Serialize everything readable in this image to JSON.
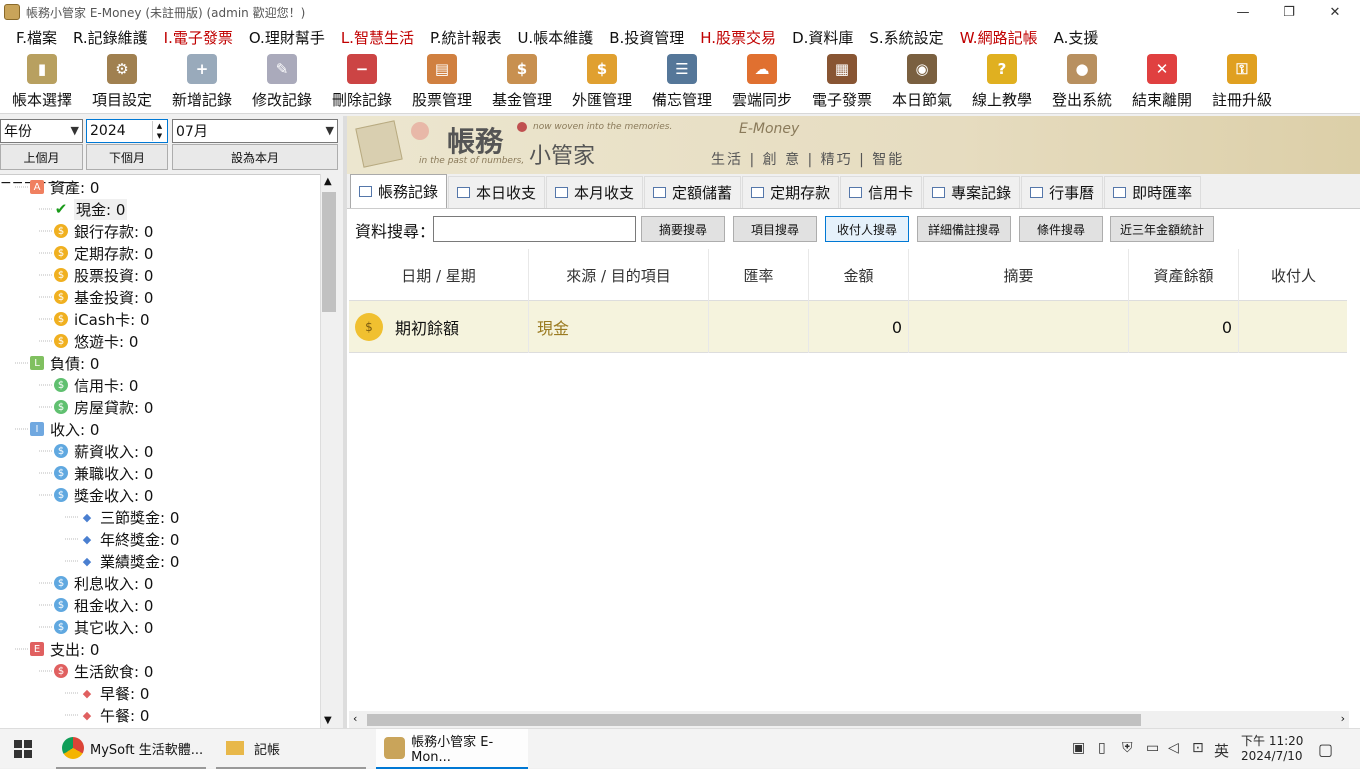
{
  "window": {
    "title": "帳務小管家 E-Money (未註冊版) (admin 歡迎您！)",
    "min": "—",
    "max": "❐",
    "close": "✕"
  },
  "menu": [
    {
      "label": "F.檔案",
      "color": "#111"
    },
    {
      "label": "R.記錄維護",
      "color": "#111"
    },
    {
      "label": "I.電子發票",
      "color": "#c00000"
    },
    {
      "label": "O.理財幫手",
      "color": "#111"
    },
    {
      "label": "L.智慧生活",
      "color": "#c00000"
    },
    {
      "label": "P.統計報表",
      "color": "#111"
    },
    {
      "label": "U.帳本維護",
      "color": "#111"
    },
    {
      "label": "B.投資管理",
      "color": "#111"
    },
    {
      "label": "H.股票交易",
      "color": "#c00000"
    },
    {
      "label": "D.資料庫",
      "color": "#111"
    },
    {
      "label": "S.系統設定",
      "color": "#111"
    },
    {
      "label": "W.網路記帳",
      "color": "#c00000"
    },
    {
      "label": "A.支援",
      "color": "#111"
    }
  ],
  "toolbar": [
    {
      "label": "帳本選擇",
      "icon": "book-icon",
      "color": "#b8a060",
      "glyph": "▮"
    },
    {
      "label": "項目設定",
      "icon": "settings-icon",
      "color": "#a08050",
      "glyph": "⚙"
    },
    {
      "label": "新增記錄",
      "icon": "add-record-icon",
      "color": "#9ab",
      "glyph": "+"
    },
    {
      "label": "修改記錄",
      "icon": "edit-record-icon",
      "color": "#aab",
      "glyph": "✎"
    },
    {
      "label": "刪除記錄",
      "icon": "delete-record-icon",
      "color": "#c44",
      "glyph": "−"
    },
    {
      "label": "股票管理",
      "icon": "stock-icon",
      "color": "#d08040",
      "glyph": "▤"
    },
    {
      "label": "基金管理",
      "icon": "fund-icon",
      "color": "#c89050",
      "glyph": "$"
    },
    {
      "label": "外匯管理",
      "icon": "forex-icon",
      "color": "#e0a030",
      "glyph": "$"
    },
    {
      "label": "備忘管理",
      "icon": "memo-icon",
      "color": "#557799",
      "glyph": "☰"
    },
    {
      "label": "雲端同步",
      "icon": "cloud-sync-icon",
      "color": "#e07030",
      "glyph": "☁"
    },
    {
      "label": "電子發票",
      "icon": "qr-invoice-icon",
      "color": "#885533",
      "glyph": "▦"
    },
    {
      "label": "本日節氣",
      "icon": "solar-term-icon",
      "color": "#7a6040",
      "glyph": "◉"
    },
    {
      "label": "線上教學",
      "icon": "help-icon",
      "color": "#e0b020",
      "glyph": "?"
    },
    {
      "label": "登出系統",
      "icon": "logout-icon",
      "color": "#b89060",
      "glyph": "●"
    },
    {
      "label": "結束離開",
      "icon": "exit-icon",
      "color": "#e04040",
      "glyph": "✕"
    },
    {
      "label": "註冊升級",
      "icon": "register-key-icon",
      "color": "#e0a020",
      "glyph": "⚿"
    }
  ],
  "left": {
    "period_type": "年份",
    "year": "2024",
    "month": "07月",
    "prev_month": "上個月",
    "next_month": "下個月",
    "set_this_month": "設為本月"
  },
  "tree": [
    {
      "label": "資產: 0",
      "level": 0,
      "badge": "A",
      "badge_color": "#f08060",
      "expander": "−"
    },
    {
      "label": "現金: 0",
      "level": 1,
      "badge": "✔",
      "badge_color": "#1a9a1a",
      "selected": true
    },
    {
      "label": "銀行存款: 0",
      "level": 1,
      "badge": "$",
      "badge_color": "#f0b020"
    },
    {
      "label": "定期存款: 0",
      "level": 1,
      "badge": "$",
      "badge_color": "#f0b020"
    },
    {
      "label": "股票投資: 0",
      "level": 1,
      "badge": "$",
      "badge_color": "#f0b020"
    },
    {
      "label": "基金投資: 0",
      "level": 1,
      "badge": "$",
      "badge_color": "#f0b020"
    },
    {
      "label": "iCash卡: 0",
      "level": 1,
      "badge": "$",
      "badge_color": "#f0b020"
    },
    {
      "label": "悠遊卡: 0",
      "level": 1,
      "badge": "$",
      "badge_color": "#f0b020"
    },
    {
      "label": "負債: 0",
      "level": 0,
      "badge": "L",
      "badge_color": "#80c060",
      "expander": "−"
    },
    {
      "label": "信用卡: 0",
      "level": 1,
      "badge": "$",
      "badge_color": "#60c070"
    },
    {
      "label": "房屋貸款: 0",
      "level": 1,
      "badge": "$",
      "badge_color": "#60c070"
    },
    {
      "label": "收入: 0",
      "level": 0,
      "badge": "I",
      "badge_color": "#70a8e0",
      "expander": "−"
    },
    {
      "label": "薪資收入: 0",
      "level": 1,
      "badge": "$",
      "badge_color": "#60a8e0"
    },
    {
      "label": "兼職收入: 0",
      "level": 1,
      "badge": "$",
      "badge_color": "#60a8e0"
    },
    {
      "label": "獎金收入: 0",
      "level": 1,
      "badge": "$",
      "badge_color": "#60a8e0",
      "expander": "−"
    },
    {
      "label": "三節獎金: 0",
      "level": 2,
      "badge": "◆",
      "badge_color": "#4a7fd0"
    },
    {
      "label": "年終獎金: 0",
      "level": 2,
      "badge": "◆",
      "badge_color": "#4a7fd0"
    },
    {
      "label": "業績獎金: 0",
      "level": 2,
      "badge": "◆",
      "badge_color": "#4a7fd0"
    },
    {
      "label": "利息收入: 0",
      "level": 1,
      "badge": "$",
      "badge_color": "#60a8e0"
    },
    {
      "label": "租金收入: 0",
      "level": 1,
      "badge": "$",
      "badge_color": "#60a8e0"
    },
    {
      "label": "其它收入: 0",
      "level": 1,
      "badge": "$",
      "badge_color": "#60a8e0"
    },
    {
      "label": "支出: 0",
      "level": 0,
      "badge": "E",
      "badge_color": "#e06060",
      "expander": "−"
    },
    {
      "label": "生活飲食: 0",
      "level": 1,
      "badge": "$",
      "badge_color": "#e06060",
      "expander": "−"
    },
    {
      "label": "早餐: 0",
      "level": 2,
      "badge": "◆",
      "badge_color": "#e06060"
    },
    {
      "label": "午餐: 0",
      "level": 2,
      "badge": "◆",
      "badge_color": "#e06060"
    }
  ],
  "banner": {
    "title1": "帳務",
    "title2": "小管家",
    "tag_en1": "now woven into the memories.",
    "tag_en2": "in the past of numbers,",
    "brand": "E-Money",
    "slogan": "生活 | 創 意 | 精巧 | 智能"
  },
  "tabs": [
    {
      "label": "帳務記錄",
      "active": true
    },
    {
      "label": "本日收支"
    },
    {
      "label": "本月收支"
    },
    {
      "label": "定額儲蓄"
    },
    {
      "label": "定期存款"
    },
    {
      "label": "信用卡"
    },
    {
      "label": "專案記錄"
    },
    {
      "label": "行事曆"
    },
    {
      "label": "即時匯率"
    }
  ],
  "search": {
    "label": "資料搜尋：",
    "value": "",
    "buttons": [
      "摘要搜尋",
      "項目搜尋",
      "收付人搜尋",
      "詳細備註搜尋",
      "條件搜尋",
      "近三年金額統計"
    ]
  },
  "grid": {
    "columns": [
      "日期 / 星期",
      "來源 / 目的項目",
      "匯率",
      "金額",
      "摘要",
      "資產餘額",
      "收付人"
    ],
    "rows": [
      {
        "date": "期初餘額",
        "item": "現金",
        "rate": "",
        "amount": "0",
        "memo": "",
        "balance": "0",
        "payee": ""
      }
    ]
  },
  "taskbar": {
    "items": [
      "MySoft 生活軟體...",
      "記帳",
      "帳務小管家 E-Mon..."
    ],
    "time": "下午 11:20",
    "date": "2024/7/10",
    "ime": "英"
  }
}
